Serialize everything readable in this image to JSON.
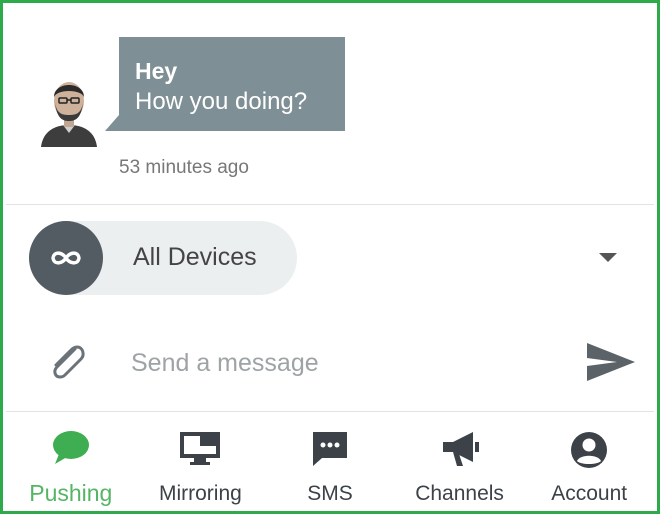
{
  "message": {
    "title": "Hey",
    "body": "How you doing?",
    "timestamp": "53 minutes ago"
  },
  "device_selector": {
    "label": "All Devices",
    "icon": "infinity-icon"
  },
  "compose": {
    "placeholder": "Send a message",
    "attach_icon": "paperclip-icon",
    "send_icon": "send-icon"
  },
  "nav": {
    "items": [
      {
        "label": "Pushing",
        "icon": "chat-bubble-icon",
        "active": true
      },
      {
        "label": "Mirroring",
        "icon": "monitor-icon",
        "active": false
      },
      {
        "label": "SMS",
        "icon": "sms-icon",
        "active": false
      },
      {
        "label": "Channels",
        "icon": "megaphone-icon",
        "active": false
      },
      {
        "label": "Account",
        "icon": "account-icon",
        "active": false
      }
    ]
  },
  "colors": {
    "accent": "#2eaa4b",
    "active_label": "#55b564",
    "bubble": "#7f8f96",
    "device_icon_bg": "#535c62"
  }
}
